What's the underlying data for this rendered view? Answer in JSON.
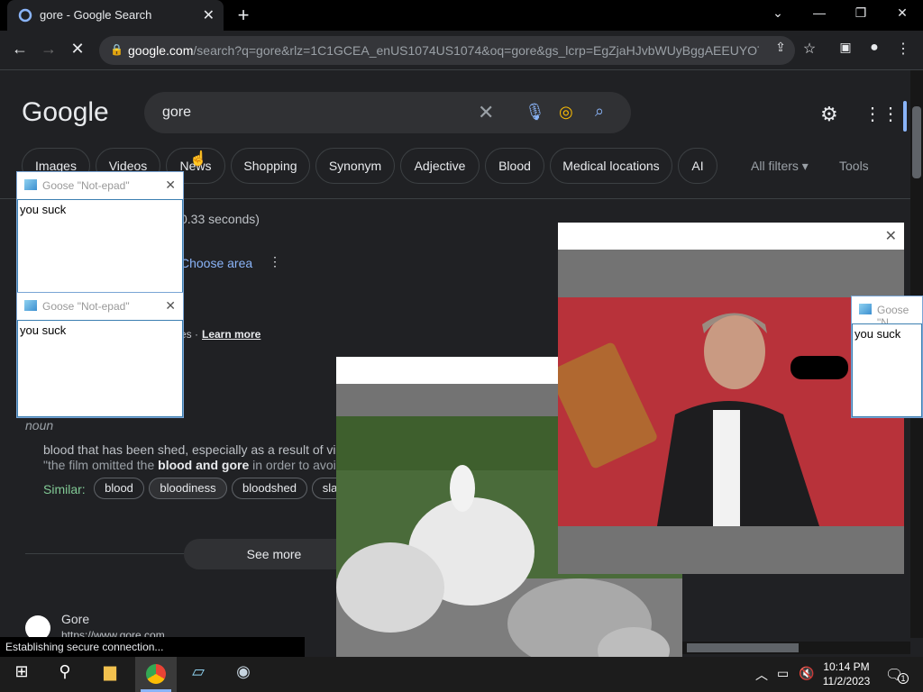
{
  "browser": {
    "tab_title": "gore - Google Search",
    "url_host": "google.com",
    "url_rest": "/search?q=gore&rlz=1C1GCEA_enUS1074US1074&oq=gore&gs_lcrp=EgZjaHJvbWUyBggAEEUYOTI...",
    "status_text": "Establishing secure connection..."
  },
  "google": {
    "logo": "Google",
    "query": "gore",
    "chips": [
      "Images",
      "Videos",
      "News",
      "Shopping",
      "Synonym",
      "Adjective",
      "Blood",
      "Medical locations",
      "AI"
    ],
    "all_filters": "All filters",
    "tools": "Tools",
    "stats_suffix": "0.33 seconds)",
    "choose_area": "Choose area",
    "learn_more": "Learn more",
    "learn_prefix": "es ·",
    "pos": "noun",
    "definition": "blood that has been shed, especially as a result of vi",
    "example_pre": "\"the film omitted the ",
    "example_bold": "blood and gore",
    "example_post": " in order to avoi",
    "similar_label": "Similar:",
    "similar": [
      "blood",
      "bloodiness",
      "bloodshed",
      "sla"
    ],
    "see_more": "See more",
    "result_title": "Gore",
    "result_url": "https://www.gore.com"
  },
  "notepads": [
    {
      "title": "Goose \"Not-epad\"",
      "text": "you suck"
    },
    {
      "title": "Goose \"Not-epad\"",
      "text": "you suck"
    },
    {
      "title": "Goose \"N",
      "text": "you suck"
    }
  ],
  "taskbar": {
    "time": "10:14 PM",
    "date": "11/2/2023",
    "notif_count": "1"
  }
}
